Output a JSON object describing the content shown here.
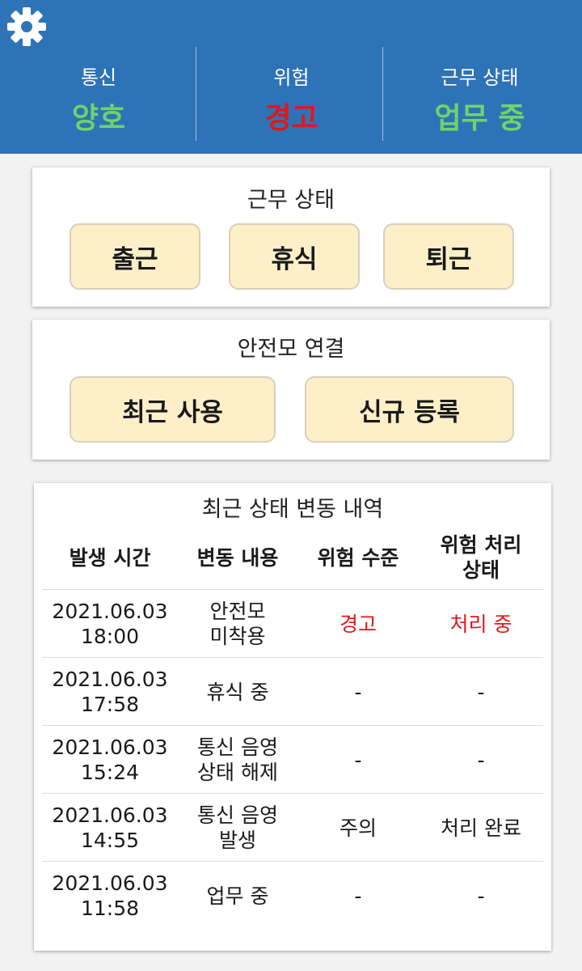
{
  "header": {
    "settings_icon": "gear-icon",
    "communication": {
      "label": "통신",
      "value": "양호",
      "color": "#6fd36a"
    },
    "danger": {
      "label": "위험",
      "value": "경고",
      "color": "#e01818"
    },
    "work_status": {
      "label": "근무 상태",
      "value": "업무 중",
      "color": "#6fd36a"
    }
  },
  "work_card": {
    "title": "근무 상태",
    "buttons": {
      "check_in": "출근",
      "rest": "휴식",
      "check_out": "퇴근"
    }
  },
  "helmet_card": {
    "title": "안전모 연결",
    "buttons": {
      "recent": "최근 사용",
      "new": "신규 등록"
    }
  },
  "history": {
    "title": "최근 상태 변동 내역",
    "columns": [
      "발생 시간",
      "변동 내용",
      "위험 수준",
      "위험 처리\n상태"
    ],
    "rows": [
      {
        "time": "2021.06.03\n18:00",
        "content": "안전모\n미착용",
        "level": "경고",
        "status": "처리 중"
      },
      {
        "time": "2021.06.03\n17:58",
        "content": "휴식 중",
        "level": "-",
        "status": "-"
      },
      {
        "time": "2021.06.03\n15:24",
        "content": "통신 음영\n상태 해제",
        "level": "-",
        "status": "-"
      },
      {
        "time": "2021.06.03\n14:55",
        "content": "통신 음영\n발생",
        "level": "주의",
        "status": "처리 완료"
      },
      {
        "time": "2021.06.03\n11:58",
        "content": "업무 중",
        "level": "-",
        "status": "-"
      }
    ]
  },
  "colors": {
    "header_bg": "#2e73b8",
    "button_bg": "#fdf0c9",
    "alert_red": "#e01818",
    "ok_green": "#6fd36a"
  }
}
